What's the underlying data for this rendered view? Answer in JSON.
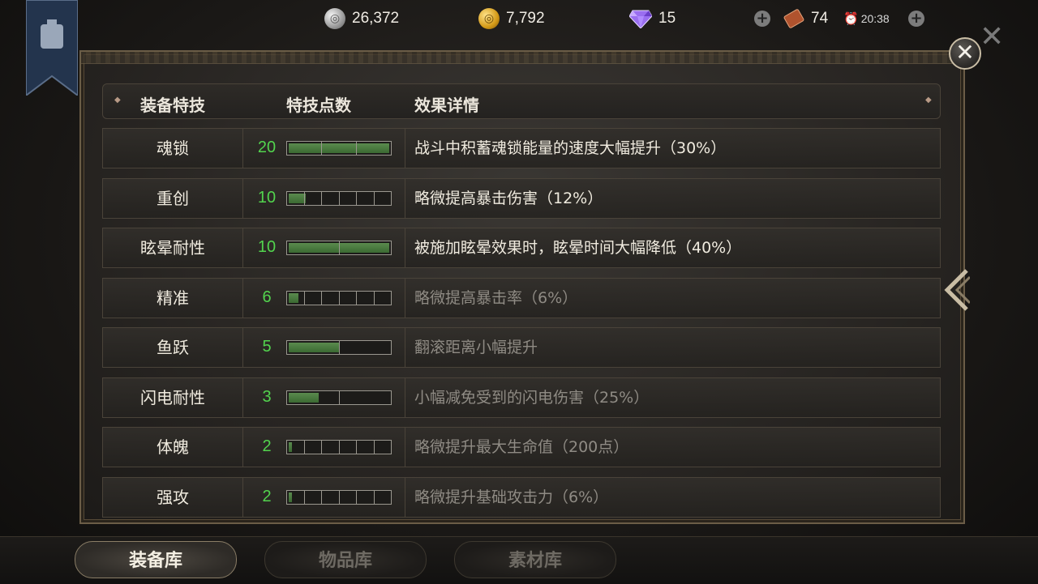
{
  "currencies": {
    "silver": "26,372",
    "gold": "7,792",
    "gem": "15",
    "tickets": "74",
    "time": "20:38"
  },
  "header": {
    "col_skill": "装备特技",
    "col_points": "特技点数",
    "col_effect": "效果详情"
  },
  "rows": [
    {
      "name": "魂锁",
      "points": "20",
      "fill": 1.0,
      "effect": "战斗中积蓄魂锁能量的速度大幅提升（30%）",
      "segments": 3,
      "active": true
    },
    {
      "name": "重创",
      "points": "10",
      "fill": 0.17,
      "effect": "略微提高暴击伤害（12%）",
      "segments": 6,
      "active": true
    },
    {
      "name": "眩晕耐性",
      "points": "10",
      "fill": 1.0,
      "effect": "被施加眩晕效果时，眩晕时间大幅降低（40%）",
      "segments": 2,
      "active": true
    },
    {
      "name": "精准",
      "points": "6",
      "fill": 0.1,
      "effect": "略微提高暴击率（6%）",
      "segments": 6,
      "active": false
    },
    {
      "name": "鱼跃",
      "points": "5",
      "fill": 0.5,
      "effect": "翻滚距离小幅提升",
      "segments": 2,
      "active": false
    },
    {
      "name": "闪电耐性",
      "points": "3",
      "fill": 0.3,
      "effect": "小幅减免受到的闪电伤害（25%）",
      "segments": 2,
      "active": false
    },
    {
      "name": "体魄",
      "points": "2",
      "fill": 0.03,
      "effect": "略微提升最大生命值（200点）",
      "segments": 6,
      "active": false
    },
    {
      "name": "强攻",
      "points": "2",
      "fill": 0.03,
      "effect": "略微提升基础攻击力（6%）",
      "segments": 6,
      "active": false
    }
  ],
  "tabs": [
    "装备库",
    "物品库",
    "素材库"
  ],
  "colors": {
    "points_green": "#52d44e",
    "bar_fill": "#4a7a40",
    "panel_border": "#6b5d47"
  },
  "icons": [
    "silver-coin-icon",
    "gold-coin-icon",
    "diamond-icon",
    "plus-icon",
    "scroll-icon",
    "alarm-clock-icon",
    "close-icon",
    "chevron-left-icon"
  ]
}
